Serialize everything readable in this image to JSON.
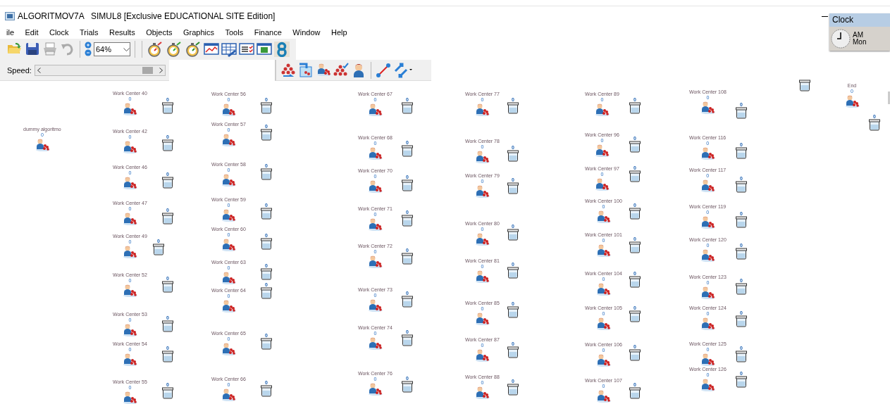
{
  "window": {
    "title": "ALGORITMOV7A   SIMUL8 [Exclusive EDUCATIONAL SITE Edition]"
  },
  "menu": [
    "ile",
    "Edit",
    "Clock",
    "Trials",
    "Results",
    "Objects",
    "Graphics",
    "Tools",
    "Finance",
    "Window",
    "Help"
  ],
  "toolbar": {
    "zoom": "64%"
  },
  "speed": {
    "label": "Speed:",
    "level": 0.9
  },
  "clock": {
    "title": "Clock",
    "period": "AM",
    "day": "Mon"
  },
  "canvas": {
    "objects": [
      {
        "kind": "work_center",
        "label": "dummy algoritmo",
        "count": "0"
      },
      {
        "kind": "work_center",
        "label": "Work Center 40",
        "count": "0",
        "queue_count": "0"
      },
      {
        "kind": "work_center",
        "label": "Work Center 42",
        "count": "0",
        "queue_count": "0"
      },
      {
        "kind": "work_center",
        "label": "Work Center 46",
        "count": "0",
        "queue_count": "0"
      },
      {
        "kind": "work_center",
        "label": "Work Center 47",
        "count": "0",
        "queue_count": "0"
      },
      {
        "kind": "work_center",
        "label": "Work Center 49",
        "count": "0",
        "queue_count": "0"
      },
      {
        "kind": "work_center",
        "label": "Work Center 52",
        "count": "0",
        "queue_count": "0"
      },
      {
        "kind": "work_center",
        "label": "Work Center 53",
        "count": "0",
        "queue_count": "0"
      },
      {
        "kind": "work_center",
        "label": "Work Center 54",
        "count": "0",
        "queue_count": "0"
      },
      {
        "kind": "work_center",
        "label": "Work Center 55",
        "count": "0",
        "queue_count": "0"
      },
      {
        "kind": "work_center",
        "label": "Work Center 56",
        "count": "0",
        "queue_count": "0"
      },
      {
        "kind": "work_center",
        "label": "Work Center 57",
        "count": "0",
        "queue_count": "0"
      },
      {
        "kind": "work_center",
        "label": "Work Center 58",
        "count": "0",
        "queue_count": "0"
      },
      {
        "kind": "work_center",
        "label": "Work Center 59",
        "count": "0",
        "queue_count": "0"
      },
      {
        "kind": "work_center",
        "label": "Work Center 60",
        "count": "0",
        "queue_count": "0"
      },
      {
        "kind": "work_center",
        "label": "Work Center 63",
        "count": "0",
        "queue_count": "0"
      },
      {
        "kind": "work_center",
        "label": "Work Center 64",
        "count": "0",
        "queue_count": "0"
      },
      {
        "kind": "work_center",
        "label": "Work Center 65",
        "count": "0",
        "queue_count": "0"
      },
      {
        "kind": "work_center",
        "label": "Work Center 66",
        "count": "0",
        "queue_count": "0"
      },
      {
        "kind": "work_center",
        "label": "Work Center 67",
        "count": "0",
        "queue_count": "0"
      },
      {
        "kind": "work_center",
        "label": "Work Center 68",
        "count": "0",
        "queue_count": "0"
      },
      {
        "kind": "work_center",
        "label": "Work Center 70",
        "count": "0",
        "queue_count": "0"
      },
      {
        "kind": "work_center",
        "label": "Work Center 71",
        "count": "0",
        "queue_count": "0"
      },
      {
        "kind": "work_center",
        "label": "Work Center 72",
        "count": "0",
        "queue_count": "0"
      },
      {
        "kind": "work_center",
        "label": "Work Center 73",
        "count": "0",
        "queue_count": "0"
      },
      {
        "kind": "work_center",
        "label": "Work Center 74",
        "count": "0",
        "queue_count": "0"
      },
      {
        "kind": "work_center",
        "label": "Work Center 76",
        "count": "0",
        "queue_count": "0"
      },
      {
        "kind": "work_center",
        "label": "Work Center 77",
        "count": "0",
        "queue_count": "0"
      },
      {
        "kind": "work_center",
        "label": "Work Center 78",
        "count": "0",
        "queue_count": "0"
      },
      {
        "kind": "work_center",
        "label": "Work Center 79",
        "count": "0",
        "queue_count": "0"
      },
      {
        "kind": "work_center",
        "label": "Work Center 80",
        "count": "0",
        "queue_count": "0"
      },
      {
        "kind": "work_center",
        "label": "Work Center 81",
        "count": "0",
        "queue_count": "0"
      },
      {
        "kind": "work_center",
        "label": "Work Center 85",
        "count": "0",
        "queue_count": "0"
      },
      {
        "kind": "work_center",
        "label": "Work Center 87",
        "count": "0",
        "queue_count": "0"
      },
      {
        "kind": "work_center",
        "label": "Work Center 88",
        "count": "0",
        "queue_count": "0"
      },
      {
        "kind": "work_center",
        "label": "Work Center 89",
        "count": "0",
        "queue_count": "0"
      },
      {
        "kind": "work_center",
        "label": "Work Center 96",
        "count": "0",
        "queue_count": "0"
      },
      {
        "kind": "work_center",
        "label": "Work Center 97",
        "count": "0",
        "queue_count": "0"
      },
      {
        "kind": "work_center",
        "label": "Work Center 100",
        "count": "0",
        "queue_count": "0"
      },
      {
        "kind": "work_center",
        "label": "Work Center 101",
        "count": "0",
        "queue_count": "0"
      },
      {
        "kind": "work_center",
        "label": "Work Center 104",
        "count": "0",
        "queue_count": "0"
      },
      {
        "kind": "work_center",
        "label": "Work Center 105",
        "count": "0",
        "queue_count": "0"
      },
      {
        "kind": "work_center",
        "label": "Work Center 106",
        "count": "0",
        "queue_count": "0"
      },
      {
        "kind": "work_center",
        "label": "Work Center 107",
        "count": "0",
        "queue_count": "0"
      },
      {
        "kind": "work_center",
        "label": "Work Center 108",
        "count": "0",
        "queue_count": "0"
      },
      {
        "kind": "work_center",
        "label": "Work Center 116",
        "count": "0",
        "queue_count": "0"
      },
      {
        "kind": "work_center",
        "label": "Work Center 117",
        "count": "0",
        "queue_count": "0"
      },
      {
        "kind": "work_center",
        "label": "Work Center 119",
        "count": "0",
        "queue_count": "0"
      },
      {
        "kind": "work_center",
        "label": "Work Center 120",
        "count": "0",
        "queue_count": "0"
      },
      {
        "kind": "work_center",
        "label": "Work Center 123",
        "count": "0",
        "queue_count": "0"
      },
      {
        "kind": "work_center",
        "label": "Work Center 124",
        "count": "0",
        "queue_count": "0"
      },
      {
        "kind": "work_center",
        "label": "Work Center 125",
        "count": "0",
        "queue_count": "0"
      },
      {
        "kind": "work_center",
        "label": "Work Center 126",
        "count": "0",
        "queue_count": "0"
      },
      {
        "kind": "work_center",
        "label": "End",
        "count": "0"
      },
      {
        "kind": "queue",
        "count": "0"
      },
      {
        "kind": "queue"
      }
    ]
  }
}
